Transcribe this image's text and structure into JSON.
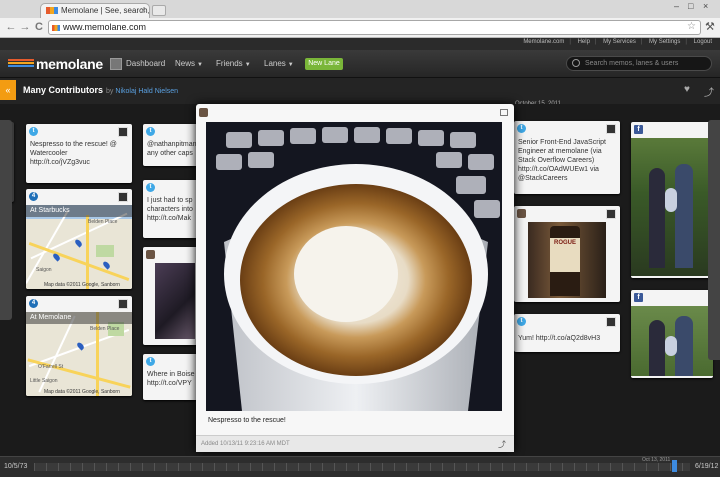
{
  "browser": {
    "tab_title": "Memolane | See, search, and",
    "url": "www.memolane.com",
    "tab_close": "×",
    "back": "←",
    "forward": "→",
    "reload": "C",
    "star": "☆",
    "wrench": "🔧"
  },
  "top_links": [
    "Memolane.com",
    "Help",
    "My Services",
    "My Settings",
    "Logout"
  ],
  "header": {
    "logo": "memolane",
    "nav": [
      {
        "label": "Dashboard"
      },
      {
        "label": "News"
      },
      {
        "label": "Friends"
      },
      {
        "label": "Lanes"
      }
    ],
    "new_lane": "New Lane",
    "search_placeholder": "Search memos, lanes & users"
  },
  "lane": {
    "back": "«",
    "title": "Many Contributors",
    "by": "by",
    "author": "Nikolaj Hald Nielsen",
    "heart": "♥",
    "share": "⤴"
  },
  "date_label": "October 15, 2011",
  "cards": {
    "c1_text": "Nespresso to the rescue! @ Watercooler http://t.co/jVZg3vuc",
    "c2_text": "@nathanpitman any other caps",
    "c3_text": "I just had to sp characters into http://t.co/Mak",
    "c4_text": "Where in Boise http://t.co/VPY",
    "map1_title": "At Starbucks",
    "map2_title": "At Memolane",
    "map_credit": "Map data ©2011 Google, Sanborn",
    "map1_labels": [
      "Belden Place",
      "Saigon"
    ],
    "map2_labels": [
      "Belden Place",
      "O'Farrell St",
      "Little Saigon"
    ],
    "r1_text": "Senior Front-End JavaScript Engineer at memolane (via Stack Overflow Careers) http://t.co/OAdWUEw1 via @StackCareers",
    "r2_text": "Yum! http://t.co/aQ2d8vH3",
    "rogue": "ROGUE"
  },
  "modal": {
    "caption": "Nespresso to the rescue!",
    "added": "Added 10/13/11 9:23:16 AM MDT",
    "share": "⤴"
  },
  "timeline": {
    "start": "10/5/73",
    "end": "6/19/12",
    "current": "Oct 13, 2011"
  }
}
